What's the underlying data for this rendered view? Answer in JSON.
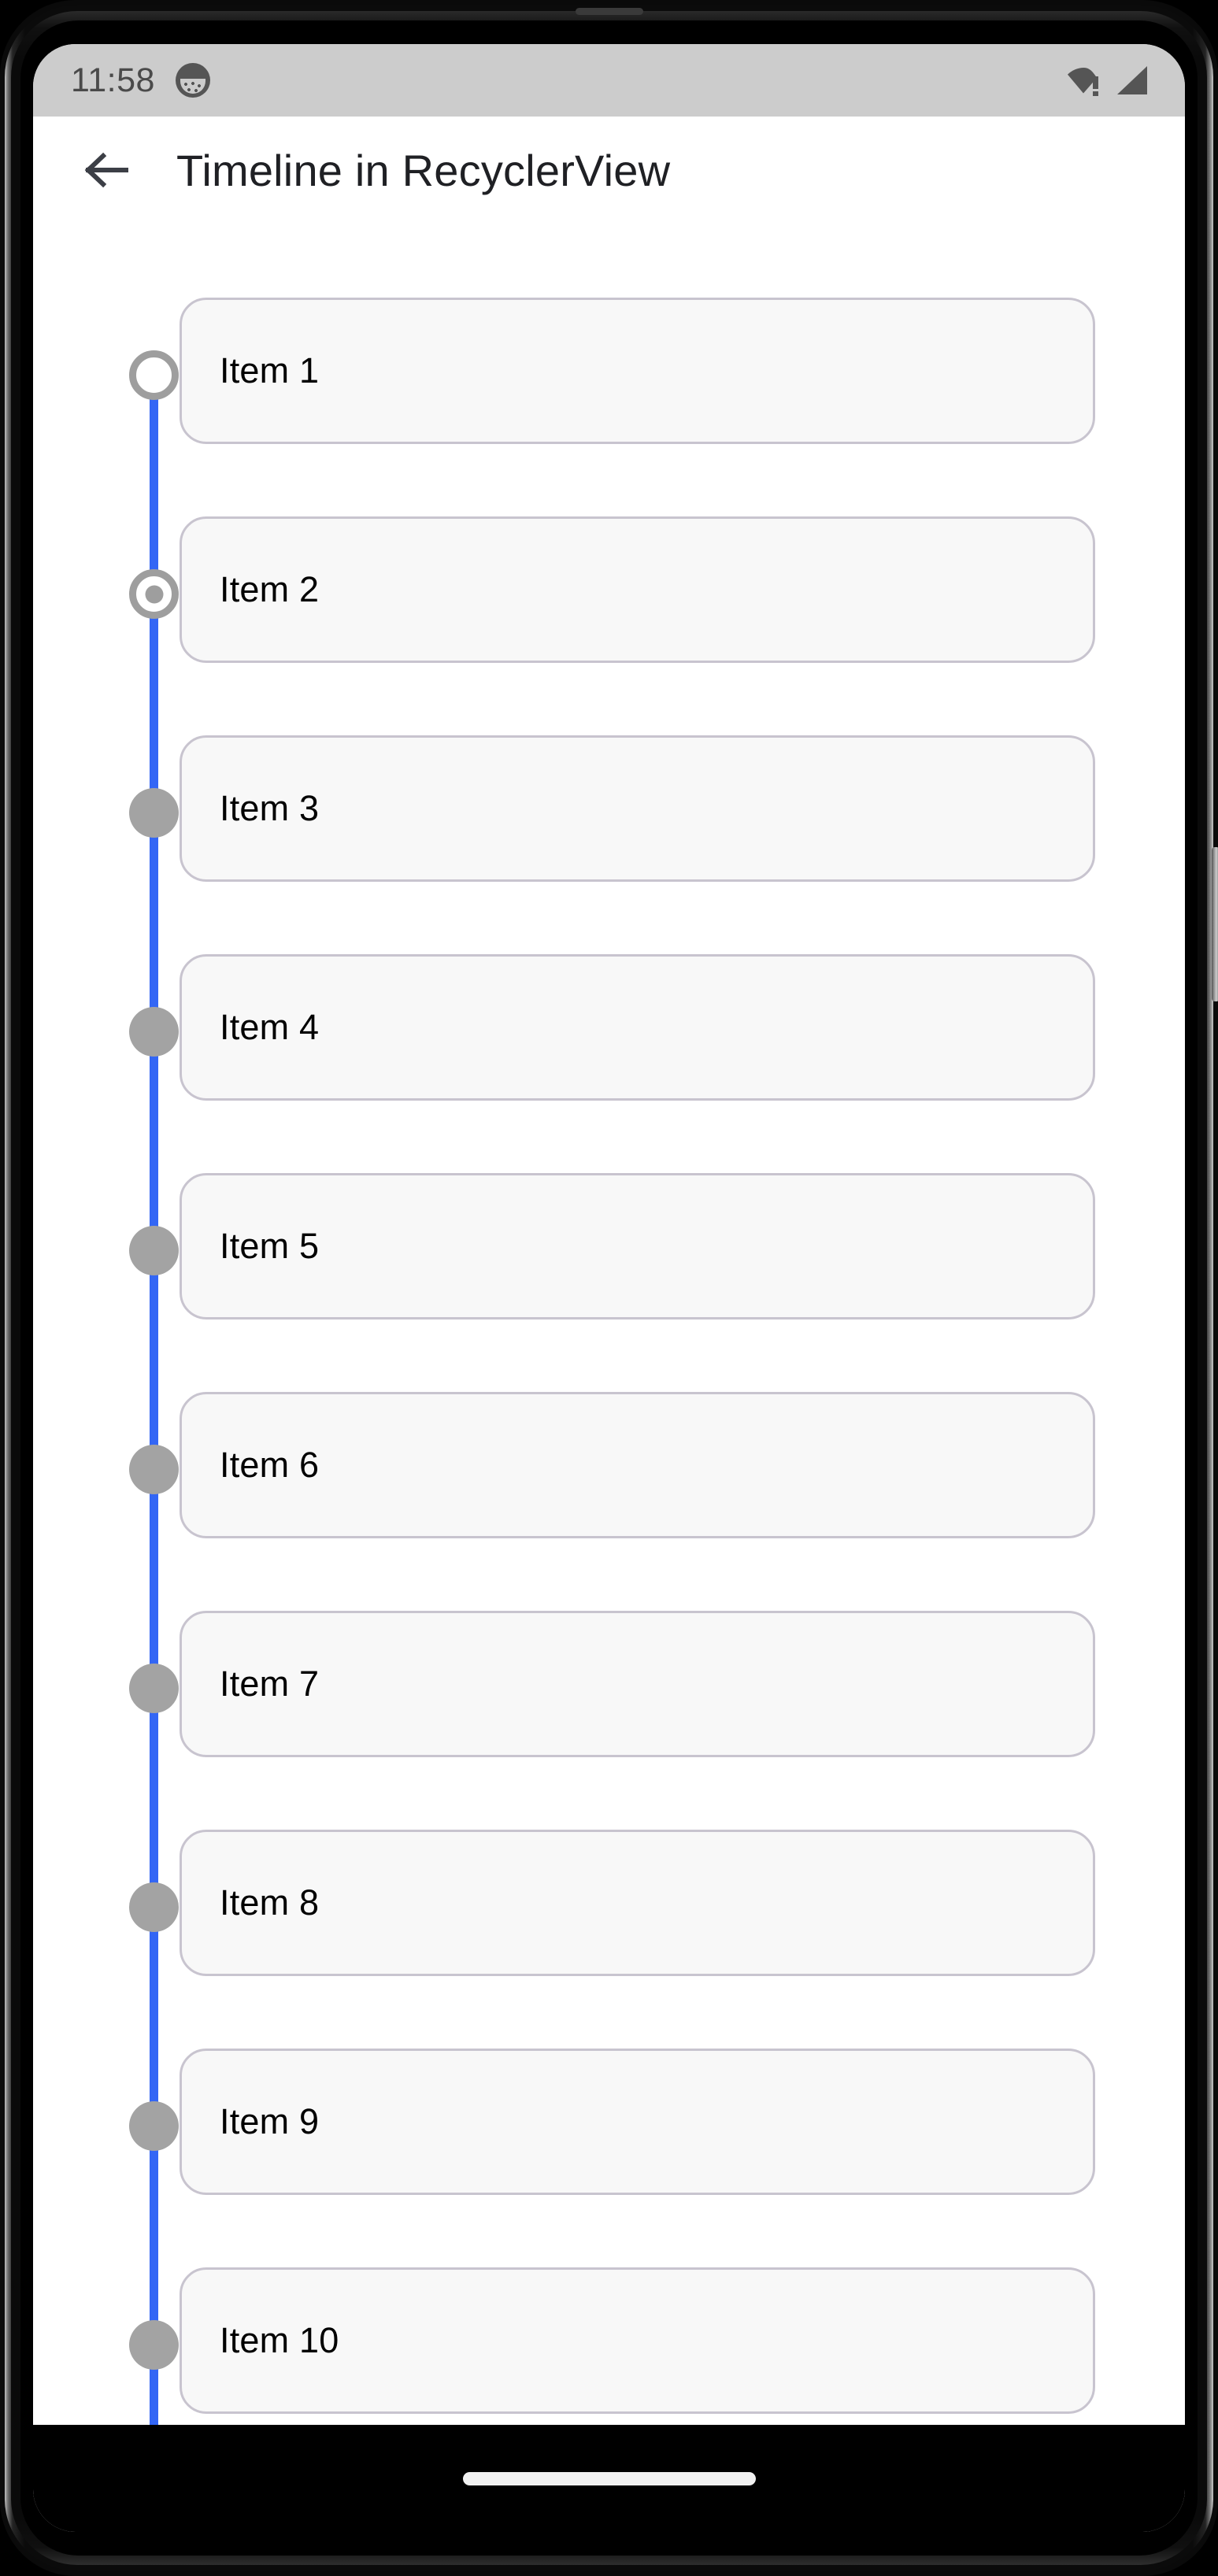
{
  "statusbar": {
    "clock": "11:58",
    "notification_icon": "app-notification-icon",
    "wifi_icon": "wifi-alert-icon",
    "signal_icon": "cellular-signal-icon",
    "background_color": "#cccccc",
    "icon_color": "#555555"
  },
  "appbar": {
    "back_icon": "back-arrow-icon",
    "title": "Timeline in RecyclerView",
    "background_color": "#ffffff",
    "title_color": "#1f2024"
  },
  "timeline": {
    "line_color": "#3366f5",
    "marker_color": "#a3a3a3",
    "marker_ring_color": "#9e9e9e",
    "card_background": "#f8f8f8",
    "card_border": "#c8c4cf",
    "items": [
      {
        "label": "Item 1",
        "marker": "hollow"
      },
      {
        "label": "Item 2",
        "marker": "ring"
      },
      {
        "label": "Item 3",
        "marker": "solid"
      },
      {
        "label": "Item 4",
        "marker": "solid"
      },
      {
        "label": "Item 5",
        "marker": "solid"
      },
      {
        "label": "Item 6",
        "marker": "solid"
      },
      {
        "label": "Item 7",
        "marker": "solid"
      },
      {
        "label": "Item 8",
        "marker": "solid"
      },
      {
        "label": "Item 9",
        "marker": "solid"
      },
      {
        "label": "Item 10",
        "marker": "solid"
      }
    ]
  },
  "navbar": {
    "home_indicator": "home-indicator",
    "background_color": "#000000"
  }
}
